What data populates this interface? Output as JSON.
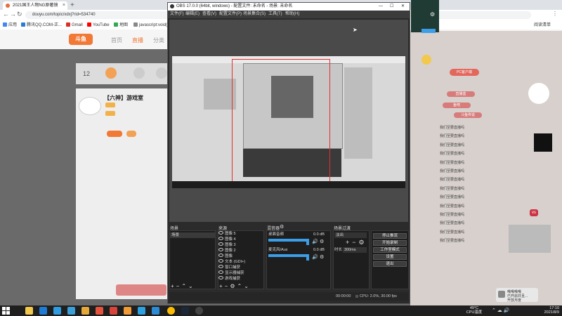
{
  "browser": {
    "tab_title": "2021国王人物NG原著镜",
    "tab_close": "×",
    "new_tab": "+",
    "url": "douyu.com/topic/xdxj?rid=534740",
    "bookmarks": [
      "应用",
      "腾讯QQ.COM-正...",
      "Gmail",
      "YouTube",
      "地图",
      "javascript:void(0...)"
    ],
    "bookmarks_right": "阅读清单"
  },
  "douyu": {
    "logo": "斗鱼",
    "nav": [
      "首页",
      "直播",
      "分类"
    ],
    "room_title": "【六神】游戏室",
    "count_big": "12",
    "right_badges": [
      "PC客户端",
      "直播盒",
      "鱼吧",
      "斗鱼传说"
    ],
    "vs_badge": "vs",
    "chat_messages": [
      "我们至要直播吗",
      "我们至要直播吗",
      "我们至要直播吗",
      "我们至要直播吗",
      "我们至要直播吗",
      "我们至要直播吗",
      "我们至要直播吗",
      "我们至要直播吗",
      "我们至要直播吗",
      "我们至要直播吗",
      "我们至要直播吗",
      "我们至要直播吗",
      "我们至要直播吗",
      "我们至要直播吗"
    ],
    "notif_title": "哦哦哦哦",
    "notif_sub": "已开启并且...",
    "notif_foot": "开放月度"
  },
  "obs": {
    "title": "OBS 17.0.0 (64bit, windows) - 配置文件: 未命名 - 场景: 未命名",
    "menu": [
      "文件(F)",
      "编辑(E)",
      "查看(V)",
      "配置文件(P)",
      "场景集合(S)",
      "工具(T)",
      "帮助(H)"
    ],
    "docks": {
      "scenes_label": "场景",
      "sources_label": "来源",
      "mixer_label": "混音器",
      "transitions_label": "场景过渡"
    },
    "scenes": [
      "场景"
    ],
    "sources": [
      "图像 5",
      "图像 4",
      "图像 3",
      "图像 2",
      "图像",
      "文本 (GDI+)",
      "窗口捕获",
      "显示器捕获",
      "游戏捕获"
    ],
    "mixer": [
      {
        "name": "桌面音频",
        "db": "0.0 dB"
      },
      {
        "name": "麦克风/Aux",
        "db": "0.0 dB"
      }
    ],
    "transition": {
      "type": "淡出",
      "duration_label": "时长",
      "duration_value": "300ms"
    },
    "controls": [
      "停止推流",
      "开始录制",
      "工作室模式",
      "设置",
      "退出"
    ],
    "status": {
      "live": "00:00:00",
      "rec": "00:00:00",
      "cpu": "CPU: 2.0%, 30.00 fps"
    }
  },
  "taskbar": {
    "temp": "49°C",
    "temp_label": "CPU温度",
    "time": "17:10",
    "date": "2021/8/9"
  },
  "colors": {
    "accent": "#f27835",
    "obs_bg": "#2b2b2b",
    "red_box": "#e03030",
    "meter": "#3d9ee8"
  }
}
